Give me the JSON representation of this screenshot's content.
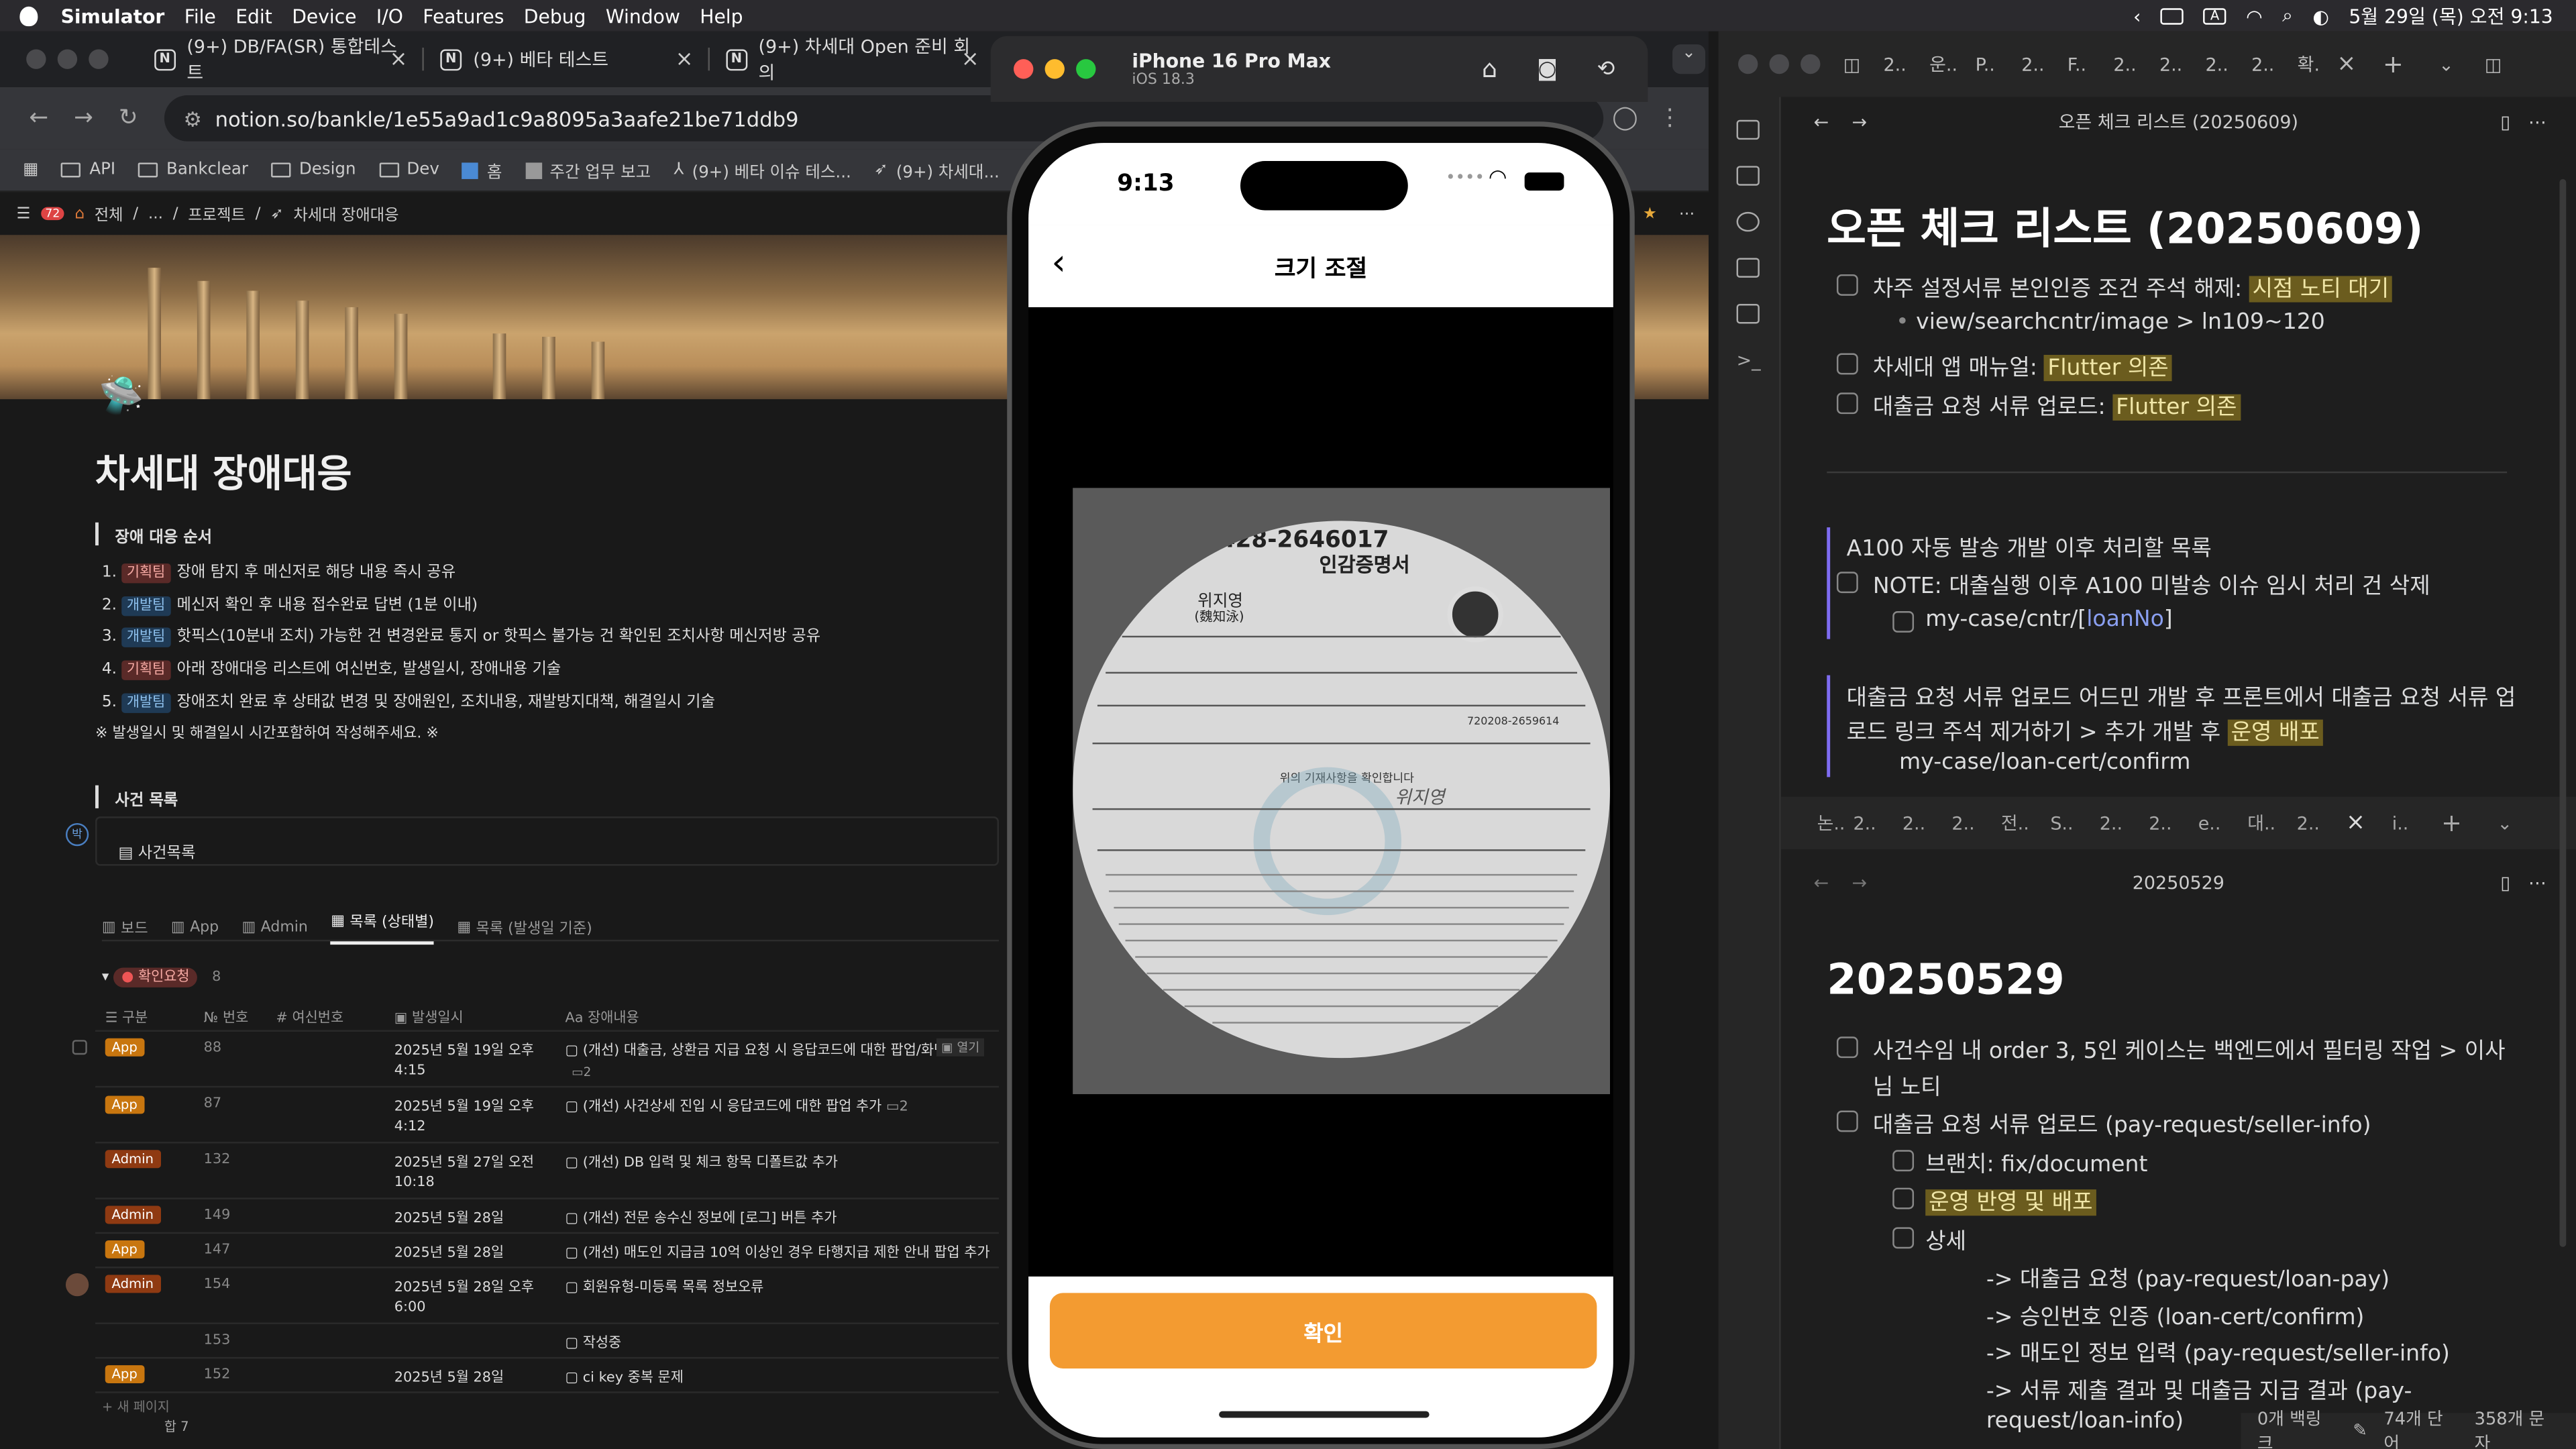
{
  "menubar": {
    "app": "Simulator",
    "menus": [
      "File",
      "Edit",
      "Device",
      "I/O",
      "Features",
      "Debug",
      "Window",
      "Help"
    ],
    "datetime": "5월 29일 (목) 오전 9:13",
    "input_icon": "A"
  },
  "browser": {
    "tabs": [
      {
        "title": "(9+) DB/FA(SR) 통합테스트",
        "icon": "N"
      },
      {
        "title": "(9+) 베타 테스트",
        "icon": "N"
      },
      {
        "title": "(9+) 차세대 Open 준비 회의",
        "icon": "N"
      }
    ],
    "url": "notion.so/bankle/1e55a9ad1c9a8095a3aafe21be71ddb9",
    "bookmarks": [
      "API",
      "Bankclear",
      "Design",
      "Dev",
      "홈",
      "주간 업무 보고",
      "(9+) 베타 이슈 테스...",
      "(9+) 차세대..."
    ],
    "breadcrumb": {
      "badge": "72",
      "items": [
        "전체",
        "...",
        "프로젝트",
        "차세대 장애대응"
      ]
    }
  },
  "notion": {
    "title": "차세대 장애대응",
    "section1_title": "장애 대응 순서",
    "steps": [
      {
        "num": "1.",
        "tag": "기획팀",
        "tag_type": "red",
        "text": "장애 탐지 후 메신저로 해당 내용 즉시 공유"
      },
      {
        "num": "2.",
        "tag": "개발팀",
        "tag_type": "blue",
        "text": "메신저 확인 후 내용 접수완료 답변 (1분 이내)"
      },
      {
        "num": "3.",
        "tag": "개발팀",
        "tag_type": "blue",
        "text": "핫픽스(10분내 조치) 가능한 건 변경완료 통지 or 핫픽스 불가능 건 확인된 조치사항 메신저방 공유"
      },
      {
        "num": "4.",
        "tag": "기획팀",
        "tag_type": "red",
        "text": "아래 장애대응 리스트에 여신번호, 발생일시, 장애내용 기술"
      },
      {
        "num": "5.",
        "tag": "개발팀",
        "tag_type": "blue",
        "text": "장애조치 완료 후 상태값 변경 및 장애원인, 조치내용, 재발방지대책, 해결일시 기술"
      }
    ],
    "note": "※ 발생일시 및 해결일시 시간포함하여 작성해주세요. ※",
    "section2_title": "사건 목록",
    "db_link": "사건목록",
    "view_tabs": [
      "보드",
      "App",
      "Admin",
      "목록 (상태별)",
      "목록 (발생일 기준)"
    ],
    "group_label": "확인요청",
    "group_count": "8",
    "columns": [
      "구분",
      "번호",
      "여신번호",
      "발생일시",
      "장애내용"
    ],
    "rows": [
      {
        "type": "App",
        "no": "88",
        "date1": "2025년 5월 19일 오후",
        "date2": "4:15",
        "content": "(개선) 대출금, 상환금 지급 요청 시 응답코드에 대한 팝업/화면",
        "extra": "열기",
        "comments": "2"
      },
      {
        "type": "App",
        "no": "87",
        "date1": "2025년 5월 19일 오후",
        "date2": "4:12",
        "content": "(개선) 사건상세 진입 시 응답코드에 대한 팝업 추가",
        "extra": "",
        "comments": "2"
      },
      {
        "type": "Admin",
        "no": "132",
        "date1": "2025년 5월 27일 오전",
        "date2": "10:18",
        "content": "(개선) DB 입력 및 체크 항목 디폴트값 추가",
        "extra": "",
        "comments": ""
      },
      {
        "type": "Admin",
        "no": "149",
        "date1": "2025년 5월 28일",
        "date2": "",
        "content": "(개선) 전문 송수신 정보에 [로그] 버튼 추가",
        "extra": "",
        "comments": ""
      },
      {
        "type": "App",
        "no": "147",
        "date1": "2025년 5월 28일",
        "date2": "",
        "content": "(개선) 매도인 지급금 10억 이상인 경우 타행지급 제한 안내 팝업 추가",
        "extra": "",
        "comments": ""
      },
      {
        "type": "Admin",
        "no": "154",
        "date1": "2025년 5월 28일 오후",
        "date2": "6:00",
        "content": "회원유형-미등록 목록 정보오류",
        "extra": "",
        "comments": ""
      },
      {
        "type": "",
        "no": "153",
        "date1": "",
        "date2": "",
        "content": "작성중",
        "extra": "",
        "comments": ""
      },
      {
        "type": "App",
        "no": "152",
        "date1": "2025년 5월 28일",
        "date2": "",
        "content": "ci key 중복 문제",
        "extra": "",
        "comments": ""
      }
    ],
    "new_page": "+ 새 페이지",
    "count_label": "합 7"
  },
  "simulator": {
    "device": "iPhone 16 Pro Max",
    "os": "iOS 18.3",
    "time": "9:13",
    "nav_title": "크기 조절",
    "confirm_label": "확인",
    "doc": {
      "title": "인감증명서",
      "name": "위지영",
      "hanja": "(魏知泳)",
      "reg_no": "720208-2659614",
      "id_fragment": "720428-2646017",
      "confirm_text": "위의 기재사항을 확인합니다",
      "signature": "위지영"
    }
  },
  "obsidian": {
    "tabs": [
      "2..",
      "운..",
      "P..",
      "2..",
      "F..",
      "2..",
      "2..",
      "2..",
      "2..",
      "확."
    ],
    "pane1": {
      "header": "오픈 체크 리스트 (20250609)",
      "title": "오픈 체크 리스트 (20250609)",
      "items": [
        {
          "text": "차주 설정서류 본인인증 조건 주석 해제: ",
          "hl": "시점 노티 대기"
        },
        {
          "bullet": "view/searchcntr/image > ln109~120"
        },
        {
          "text": "차세대 앱 매뉴얼: ",
          "hl": "Flutter 의존"
        },
        {
          "text": "대출금 요청 서류 업로드: ",
          "hl": "Flutter 의존"
        }
      ],
      "quote1_title": "A100 자동 발송 개발 이후 처리할 목록",
      "quote1_item": "NOTE: 대출실행 이후 A100 미발송 이슈 임시 처리 건 삭제",
      "quote1_sub_prefix": "my-case/cntr/[",
      "quote1_sub_link": "loanNo",
      "quote1_sub_suffix": "]",
      "quote2_line1": "대출금 요청 서류 업로드 어드민 개발 후 프론트에서 대출금 요청 서류 업",
      "quote2_line2": "로드 링크 주석 제거하기 > 추가 개발 후 ",
      "quote2_hl": "운영 배포",
      "quote2_line3": "my-case/loan-cert/confirm"
    },
    "subtabs": [
      "논..",
      "2..",
      "2..",
      "2..",
      "전..",
      "S..",
      "2..",
      "2..",
      "e..",
      "대..",
      "2..",
      "i.."
    ],
    "pane2": {
      "header": "20250529",
      "title": "20250529",
      "item1a": "사건수임 내 order 3, 5인 케이스는 백엔드에서 필터링 작업 > 이사",
      "item1b": "님 노티",
      "item2": "대출금 요청 서류 업로드 (pay-request/seller-info)",
      "sub1": "브랜치: fix/document",
      "sub2_hl": "운영 반영 및 배포",
      "sub3": "상세",
      "flow": [
        "-> 대출금 요청 (pay-request/loan-pay)",
        "-> 승인번호 인증 (loan-cert/confirm)",
        "-> 매도인 정보 입력 (pay-request/seller-info)",
        "-> 서류 제출 결과 및 대출금 지급 결과 (pay-",
        "request/loan-info)"
      ]
    },
    "status": {
      "backlinks": "0개 백링크",
      "words": "74개 단어",
      "chars": "358개 문자"
    }
  }
}
